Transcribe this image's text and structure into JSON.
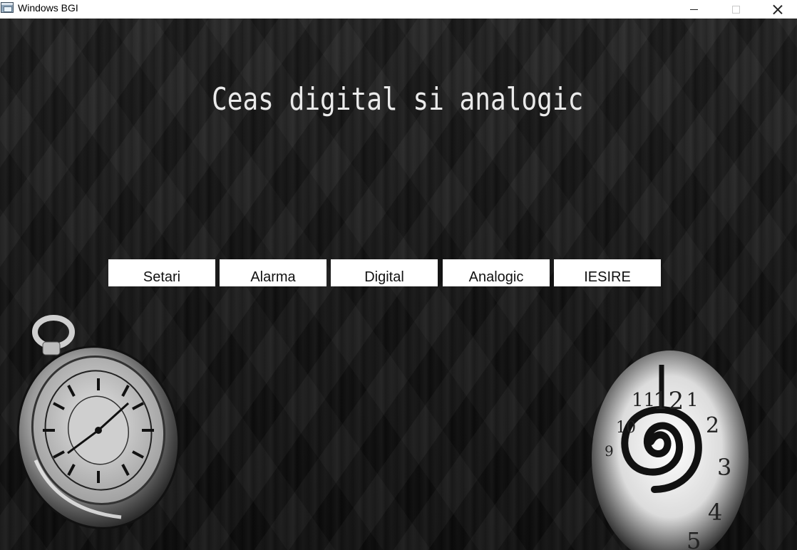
{
  "window": {
    "title": "Windows BGI"
  },
  "app": {
    "title": "Ceas digital si analogic",
    "buttons": [
      "Setari",
      "Alarma",
      "Digital",
      "Analogic",
      "IESIRE"
    ]
  },
  "images": {
    "left": "pocket-watch-icon",
    "right": "spiral-clock-icon"
  },
  "colors": {
    "background": "#161616",
    "title_text": "#eaeaea",
    "button_bg": "#ffffff",
    "button_text": "#111111"
  }
}
